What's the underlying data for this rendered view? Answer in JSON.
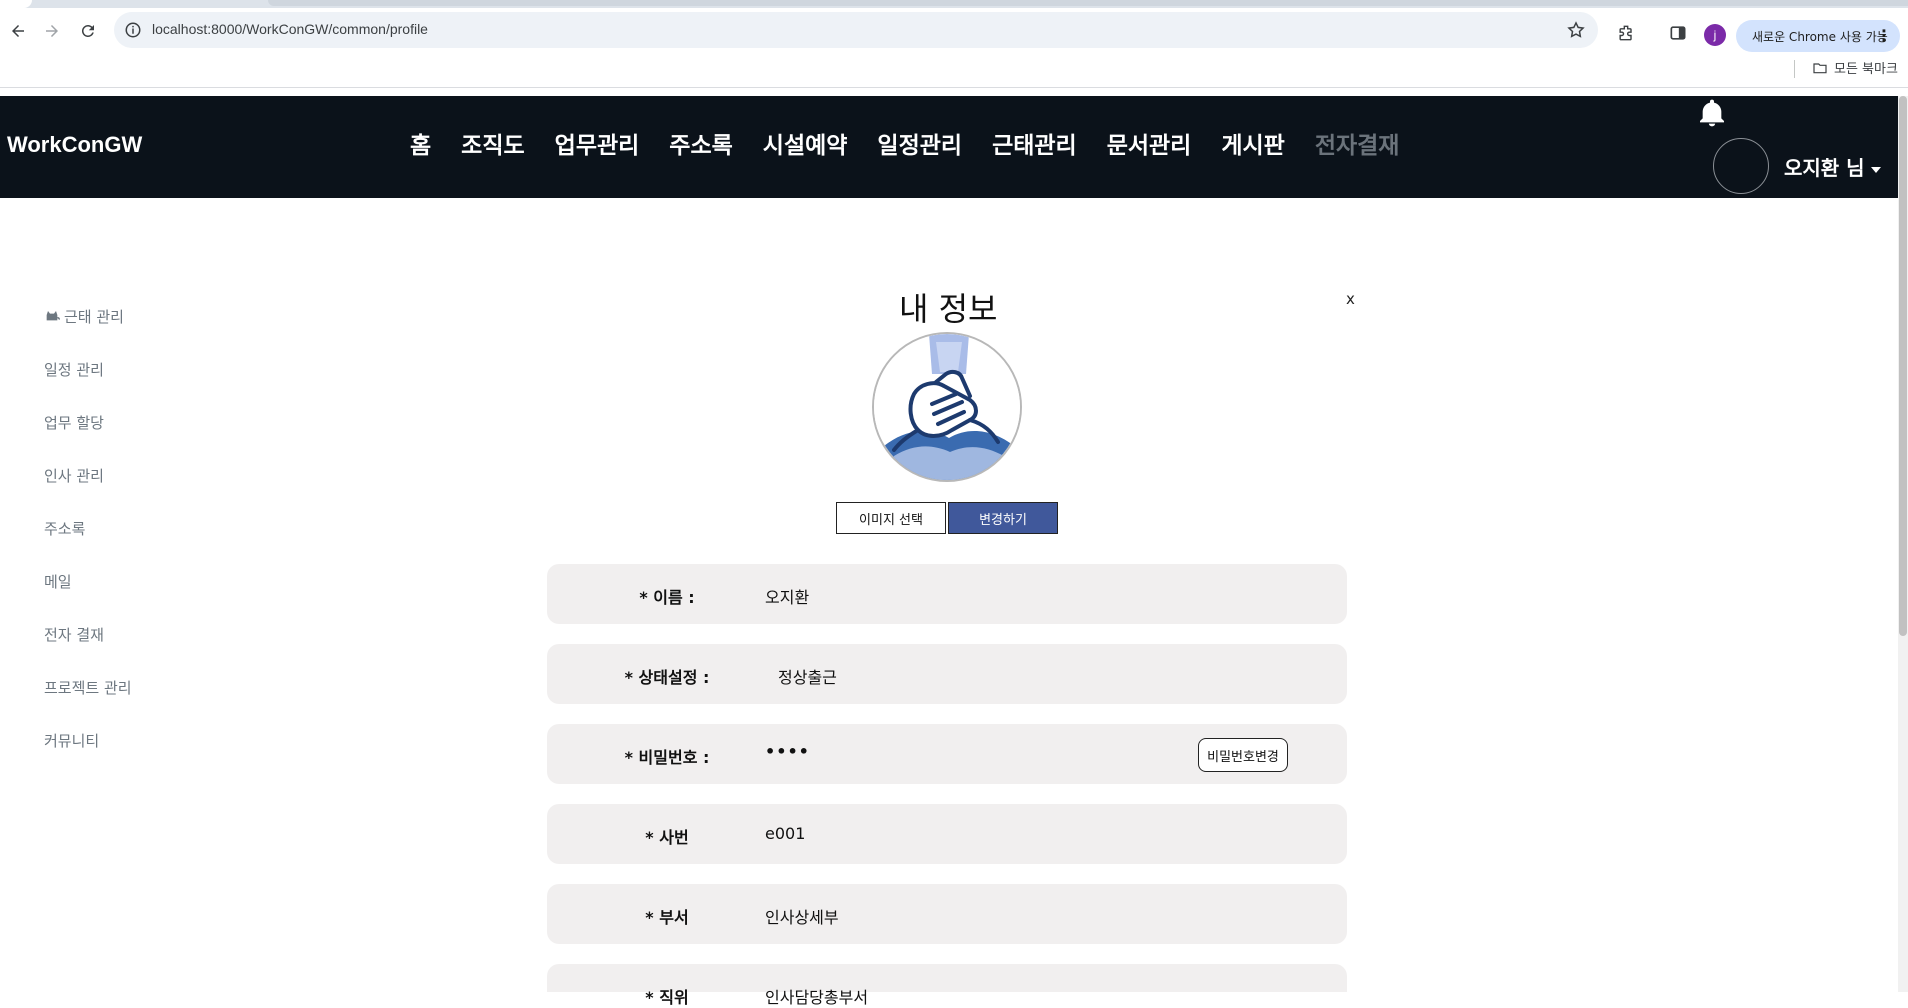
{
  "browser": {
    "url": "localhost:8000/WorkConGW/common/profile",
    "profile_initial": "j",
    "chrome_pill": "새로운 Chrome 사용 가능",
    "all_bookmarks": "모든 북마크"
  },
  "header": {
    "brand": "WorkConGW",
    "nav": [
      "홈",
      "조직도",
      "업무관리",
      "주소록",
      "시설예약",
      "일정관리",
      "근태관리",
      "문서관리",
      "게시판",
      "전자결재"
    ],
    "user_name": "오지환 님"
  },
  "sidebar": {
    "items": [
      "근태 관리",
      "일정 관리",
      "업무 할당",
      "인사 관리",
      "주소록",
      "메일",
      "전자 결재",
      "프로젝트 관리",
      "커뮤니티"
    ]
  },
  "profile": {
    "title": "내 정보",
    "close": "x",
    "select_image": "이미지 선택",
    "change": "변경하기",
    "fields": {
      "name_label": "* 이름 :",
      "name_value": "오지환",
      "status_label": "* 상태설정 :",
      "status_value": "정상출근",
      "password_label": "* 비밀번호 :",
      "password_value": "••••",
      "password_button": "비밀번호변경",
      "empno_label": "* 사번",
      "empno_value": "e001",
      "dept_label": "* 부서",
      "dept_value": "인사상세부",
      "position_label": "* 직위",
      "position_value": "인사담당총부서"
    }
  },
  "colors": {
    "header_bg": "#0b121a",
    "accent_button": "#40589b",
    "row_bg": "#f1efef"
  }
}
